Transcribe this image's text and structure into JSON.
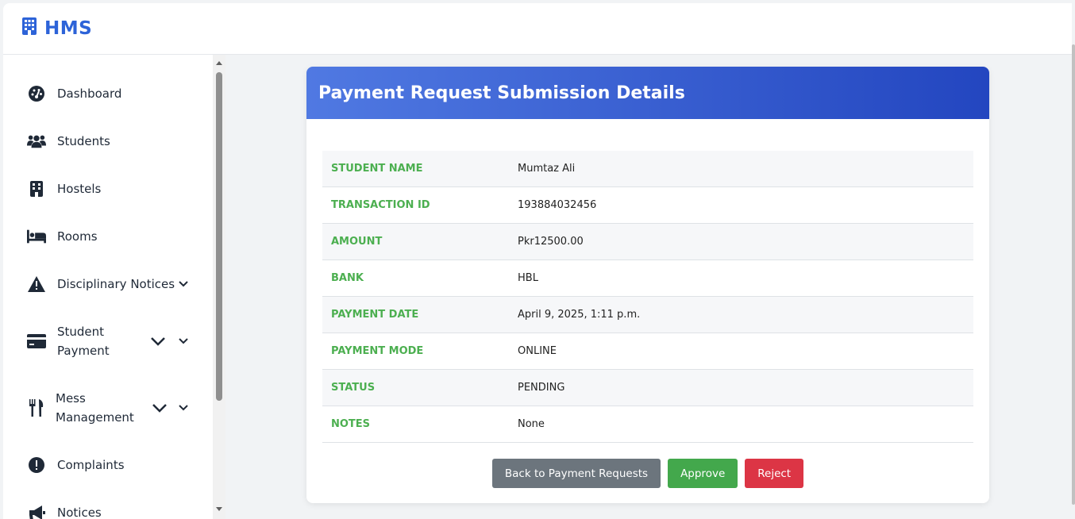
{
  "app": {
    "brand": "HMS"
  },
  "sidebar": {
    "items": [
      {
        "label": "Dashboard",
        "icon": "gauge-icon"
      },
      {
        "label": "Students",
        "icon": "users-icon"
      },
      {
        "label": "Hostels",
        "icon": "building-icon"
      },
      {
        "label": "Rooms",
        "icon": "bed-icon"
      },
      {
        "label": "Disciplinary Notices",
        "icon": "warning-icon"
      },
      {
        "label_line1": "Student",
        "label_line2": "Payment",
        "icon": "credit-card-icon"
      },
      {
        "label_line1": "Mess",
        "label_line2": "Management",
        "icon": "utensils-icon"
      },
      {
        "label": "Complaints",
        "icon": "exclamation-circle-icon"
      },
      {
        "label": "Notices",
        "icon": "bullhorn-icon"
      }
    ]
  },
  "page": {
    "title": "Payment Request Submission Details",
    "details": [
      {
        "label": "STUDENT NAME",
        "value": "Mumtaz Ali"
      },
      {
        "label": "TRANSACTION ID",
        "value": "193884032456"
      },
      {
        "label": "AMOUNT",
        "value": "Pkr12500.00"
      },
      {
        "label": "BANK",
        "value": "HBL"
      },
      {
        "label": "PAYMENT DATE",
        "value": "April 9, 2025, 1:11 p.m."
      },
      {
        "label": "PAYMENT MODE",
        "value": "ONLINE"
      },
      {
        "label": "STATUS",
        "value": "PENDING"
      },
      {
        "label": "NOTES",
        "value": "None"
      }
    ],
    "actions": {
      "back_label": "Back to Payment Requests",
      "approve_label": "Approve",
      "reject_label": "Reject"
    }
  },
  "colors": {
    "brand": "#2d63d8",
    "header_start": "#5079e2",
    "header_end": "#2346c0",
    "label_green": "#4caf50",
    "approve": "#43a84c",
    "reject": "#dc3545",
    "back": "#6c757d"
  }
}
